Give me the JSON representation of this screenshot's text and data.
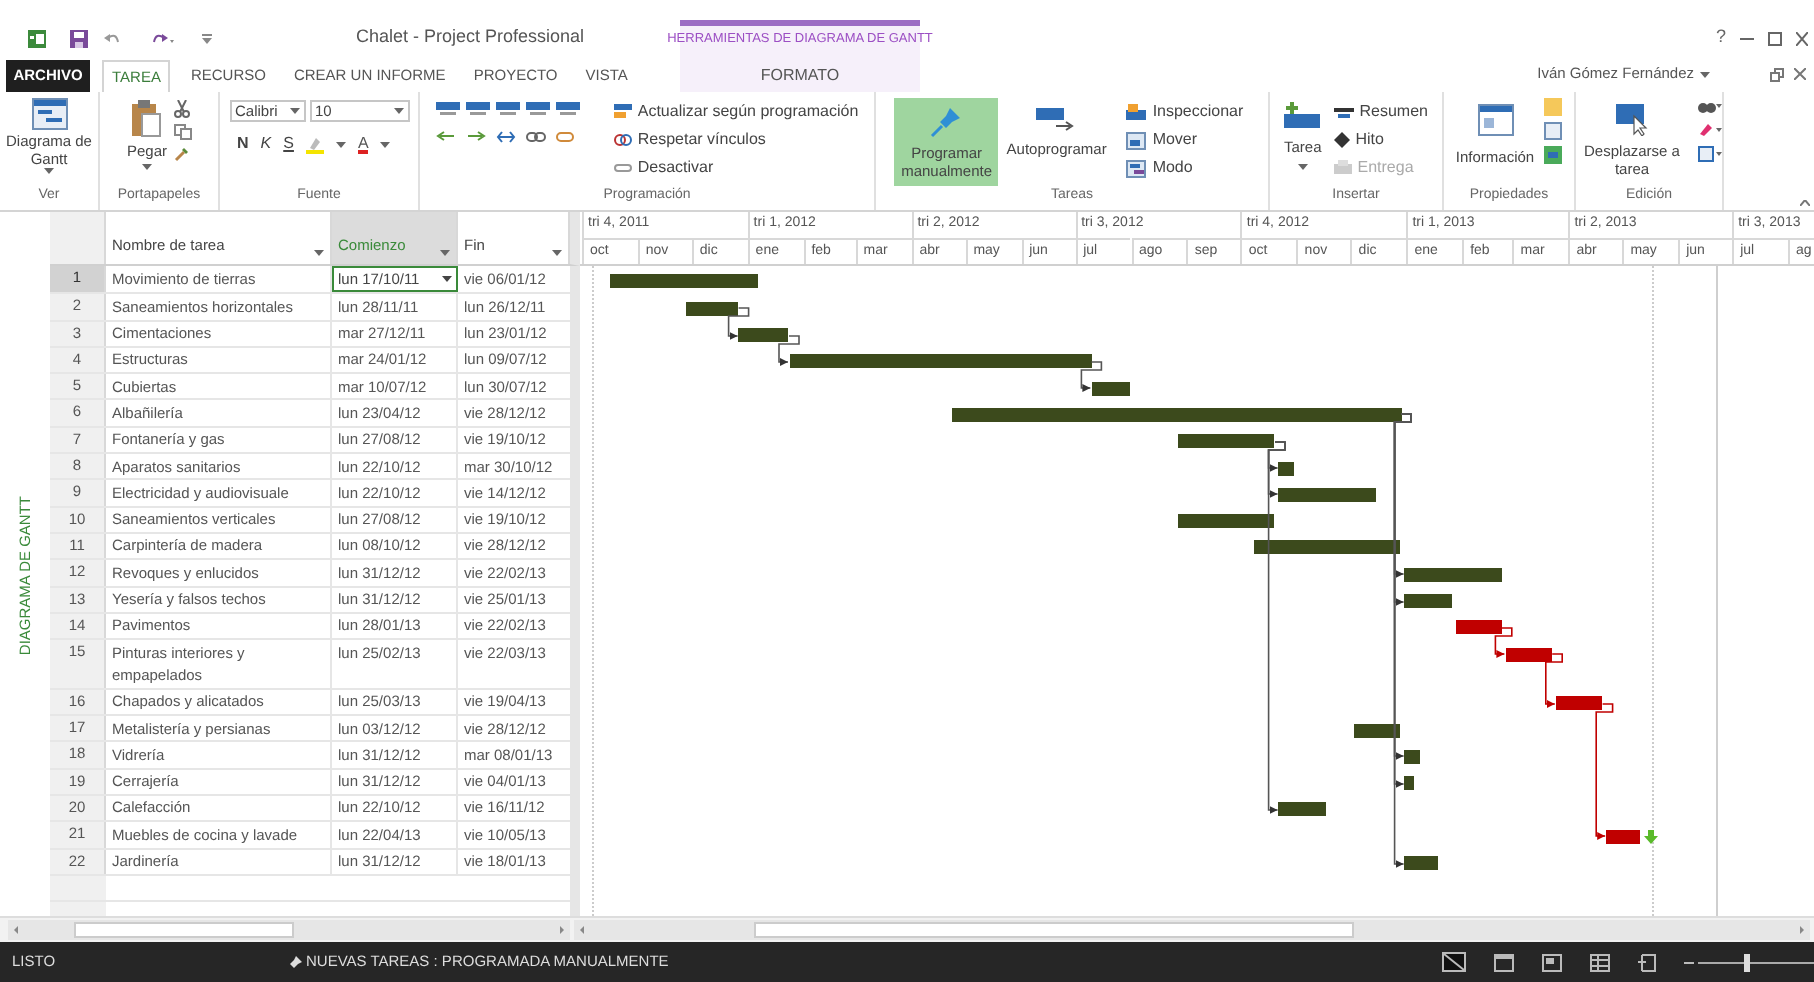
{
  "window": {
    "title": "Chalet - Project Professional",
    "context_group": "HERRAMIENTAS DE DIAGRAMA DE GANTT",
    "user": "Iván Gómez Fernández",
    "help": "?"
  },
  "tabs": [
    {
      "label": "ARCHIVO",
      "kind": "file",
      "selected": false
    },
    {
      "label": "TAREA",
      "kind": "tab",
      "selected": true
    },
    {
      "label": "RECURSO",
      "kind": "tab",
      "selected": false
    },
    {
      "label": "CREAR UN INFORME",
      "kind": "tab",
      "selected": false
    },
    {
      "label": "PROYECTO",
      "kind": "tab",
      "selected": false
    },
    {
      "label": "VISTA",
      "kind": "tab",
      "selected": false
    },
    {
      "label": "FORMATO",
      "kind": "context",
      "selected": false
    }
  ],
  "ribbon": [
    {
      "label": "Ver",
      "kind": "view",
      "button": "Diagrama de Gantt"
    },
    {
      "label": "Portapapeles",
      "kind": "clipboard",
      "button": "Pegar"
    },
    {
      "label": "Fuente",
      "kind": "font",
      "font": "Calibri",
      "size": "10",
      "styles": [
        {
          "label": "N",
          "kind": "bold"
        },
        {
          "label": "K",
          "kind": "italic"
        },
        {
          "label": "S",
          "kind": "underline"
        }
      ],
      "font_color": "A"
    },
    {
      "label": "Programación",
      "kind": "schedule",
      "items": [
        {
          "label": "Actualizar según programación",
          "kind": "update"
        },
        {
          "label": "Respetar vínculos",
          "kind": "respect"
        },
        {
          "label": "Desactivar",
          "kind": "inactivate"
        }
      ]
    },
    {
      "label": "Tareas",
      "kind": "tasks",
      "big": [
        {
          "label": "Programar manualmente",
          "kind": "pin",
          "selected": true
        },
        {
          "label": "Autoprogramar",
          "kind": "auto",
          "selected": false
        }
      ],
      "items": [
        {
          "label": "Inspeccionar",
          "kind": "inspect"
        },
        {
          "label": "Mover",
          "kind": "move"
        },
        {
          "label": "Modo",
          "kind": "mode"
        }
      ]
    },
    {
      "label": "Insertar",
      "kind": "insert",
      "button": "Tarea",
      "items": [
        {
          "label": "Resumen",
          "kind": "summary",
          "disabled": false
        },
        {
          "label": "Hito",
          "kind": "milestone",
          "disabled": false
        },
        {
          "label": "Entrega",
          "kind": "deliverable",
          "disabled": true
        }
      ]
    },
    {
      "label": "Propiedades",
      "kind": "properties",
      "button": "Información"
    },
    {
      "label": "Edición",
      "kind": "editing",
      "button": "Desplazarse a tarea"
    }
  ],
  "table": {
    "side_label": "DIAGRAMA DE GANTT",
    "columns": [
      {
        "label": "Nombre de tarea",
        "selected": false
      },
      {
        "label": "Comienzo",
        "selected": true
      },
      {
        "label": "Fin",
        "selected": false
      }
    ]
  },
  "timescale": {
    "quarters": [
      "tri 4, 2011",
      "tri 1, 2012",
      "tri 2, 2012",
      "tri 3, 2012",
      "tri 4, 2012",
      "tri 1, 2013",
      "tri 2, 2013",
      "tri 3, 2013"
    ],
    "months": [
      "oct",
      "nov",
      "dic",
      "ene",
      "feb",
      "mar",
      "abr",
      "may",
      "jun",
      "jul",
      "ago",
      "sep",
      "oct",
      "nov",
      "dic",
      "ene",
      "feb",
      "mar",
      "abr",
      "may",
      "jun",
      "jul",
      "ag"
    ]
  },
  "tasks": [
    {
      "id": "1",
      "name": "Movimiento de tierras",
      "start": "lun 17/10/11",
      "end": "vie 06/01/12",
      "selected": true,
      "critical": false,
      "deadline": false,
      "linked": false
    },
    {
      "id": "2",
      "name": "Saneamientos horizontales",
      "start": "lun 28/11/11",
      "end": "lun 26/12/11",
      "selected": false,
      "critical": false,
      "deadline": false,
      "linked": false
    },
    {
      "id": "3",
      "name": "Cimentaciones",
      "start": "mar 27/12/11",
      "end": "lun 23/01/12",
      "selected": false,
      "critical": false,
      "deadline": false,
      "linked": true
    },
    {
      "id": "4",
      "name": "Estructuras",
      "start": "mar 24/01/12",
      "end": "lun 09/07/12",
      "selected": false,
      "critical": false,
      "deadline": false,
      "linked": true
    },
    {
      "id": "5",
      "name": "Cubiertas",
      "start": "mar 10/07/12",
      "end": "lun 30/07/12",
      "selected": false,
      "critical": false,
      "deadline": false,
      "linked": true
    },
    {
      "id": "6",
      "name": "Albañilería",
      "start": "lun 23/04/12",
      "end": "vie 28/12/12",
      "selected": false,
      "critical": false,
      "deadline": false,
      "linked": false
    },
    {
      "id": "7",
      "name": "Fontanería y gas",
      "start": "lun 27/08/12",
      "end": "vie 19/10/12",
      "selected": false,
      "critical": false,
      "deadline": false,
      "linked": false
    },
    {
      "id": "8",
      "name": "Aparatos sanitarios",
      "start": "lun 22/10/12",
      "end": "mar 30/10/12",
      "selected": false,
      "critical": false,
      "deadline": false,
      "linked": true
    },
    {
      "id": "9",
      "name": "Electricidad y audiovisuale",
      "start": "lun 22/10/12",
      "end": "vie 14/12/12",
      "selected": false,
      "critical": false,
      "deadline": false,
      "linked": true
    },
    {
      "id": "10",
      "name": "Saneamientos verticales",
      "start": "lun 27/08/12",
      "end": "vie 19/10/12",
      "selected": false,
      "critical": false,
      "deadline": false,
      "linked": false
    },
    {
      "id": "11",
      "name": "Carpintería de madera",
      "start": "lun 08/10/12",
      "end": "vie 28/12/12",
      "selected": false,
      "critical": false,
      "deadline": false,
      "linked": false
    },
    {
      "id": "12",
      "name": "Revoques y enlucidos",
      "start": "lun 31/12/12",
      "end": "vie 22/02/13",
      "selected": false,
      "critical": false,
      "deadline": false,
      "linked": true
    },
    {
      "id": "13",
      "name": "Yesería y falsos techos",
      "start": "lun 31/12/12",
      "end": "vie 25/01/13",
      "selected": false,
      "critical": false,
      "deadline": false,
      "linked": true
    },
    {
      "id": "14",
      "name": "Pavimentos",
      "start": "lun 28/01/13",
      "end": "vie 22/02/13",
      "selected": false,
      "critical": true,
      "deadline": false,
      "linked": false
    },
    {
      "id": "15",
      "name": "Pinturas interiores y empapelados",
      "start": "lun 25/02/13",
      "end": "vie 22/03/13",
      "selected": false,
      "critical": true,
      "deadline": false,
      "linked": true
    },
    {
      "id": "16",
      "name": "Chapados y alicatados",
      "start": "lun 25/03/13",
      "end": "vie 19/04/13",
      "selected": false,
      "critical": true,
      "deadline": false,
      "linked": true
    },
    {
      "id": "17",
      "name": "Metalistería y persianas",
      "start": "lun 03/12/12",
      "end": "vie 28/12/12",
      "selected": false,
      "critical": false,
      "deadline": false,
      "linked": false
    },
    {
      "id": "18",
      "name": "Vidrería",
      "start": "lun 31/12/12",
      "end": "mar 08/01/13",
      "selected": false,
      "critical": false,
      "deadline": false,
      "linked": true
    },
    {
      "id": "19",
      "name": "Cerrajería",
      "start": "lun 31/12/12",
      "end": "vie 04/01/13",
      "selected": false,
      "critical": false,
      "deadline": false,
      "linked": true
    },
    {
      "id": "20",
      "name": "Calefacción",
      "start": "lun 22/10/12",
      "end": "vie 16/11/12",
      "selected": false,
      "critical": false,
      "deadline": false,
      "linked": true
    },
    {
      "id": "21",
      "name": "Muebles de cocina y lavade",
      "start": "lun 22/04/13",
      "end": "vie 10/05/13",
      "selected": false,
      "critical": true,
      "deadline": true,
      "linked": true
    },
    {
      "id": "22",
      "name": "Jardinería",
      "start": "lun 31/12/12",
      "end": "vie 18/01/13",
      "selected": false,
      "critical": false,
      "deadline": false,
      "linked": true
    }
  ],
  "status_bar": {
    "mode": "LISTO",
    "new_tasks": "NUEVAS TAREAS : PROGRAMADA MANUALMENTE",
    "zoom": {
      "level": 0.42
    }
  }
}
